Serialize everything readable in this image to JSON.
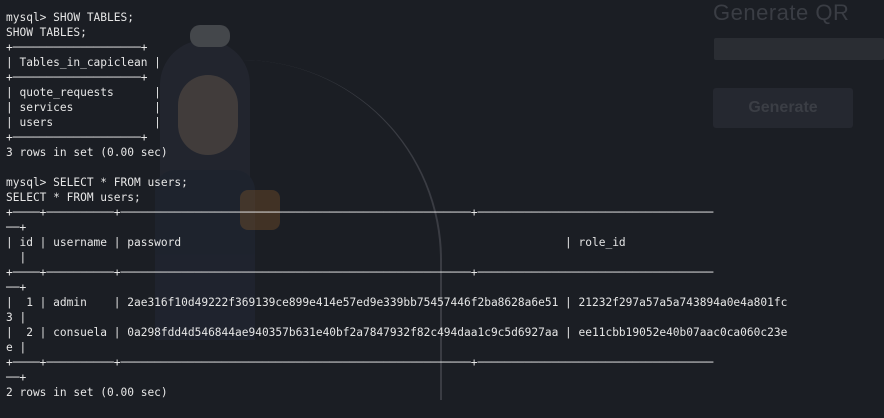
{
  "background": {
    "title": "Generate QR",
    "button_label": "Generate"
  },
  "terminal": {
    "lines": [
      "mysql> SHOW TABLES;",
      "SHOW TABLES;",
      "+───────────────────+",
      "| Tables_in_capiclean |",
      "+───────────────────+",
      "| quote_requests      |",
      "| services            |",
      "| users               |",
      "+───────────────────+",
      "3 rows in set (0.00 sec)",
      "",
      "mysql> SELECT * FROM users;",
      "SELECT * FROM users;",
      "+────+──────────+────────────────────────────────────────────────────+───────────────────────────────────",
      "──+",
      "| id | username | password                                                         | role_id",
      "  |",
      "+────+──────────+────────────────────────────────────────────────────+───────────────────────────────────",
      "──+",
      "|  1 | admin    | 2ae316f10d49222f369139ce899e414e57ed9e339bb75457446f2ba8628a6e51 | 21232f297a57a5a743894a0e4a801fc",
      "3 |",
      "|  2 | consuela | 0a298fdd4d546844ae940357b631e40bf2a7847932f82c494daa1c9c5d6927aa | ee11cbb19052e40b07aac0ca060c23e",
      "e |",
      "+────+──────────+────────────────────────────────────────────────────+───────────────────────────────────",
      "──+",
      "2 rows in set (0.00 sec)"
    ]
  }
}
